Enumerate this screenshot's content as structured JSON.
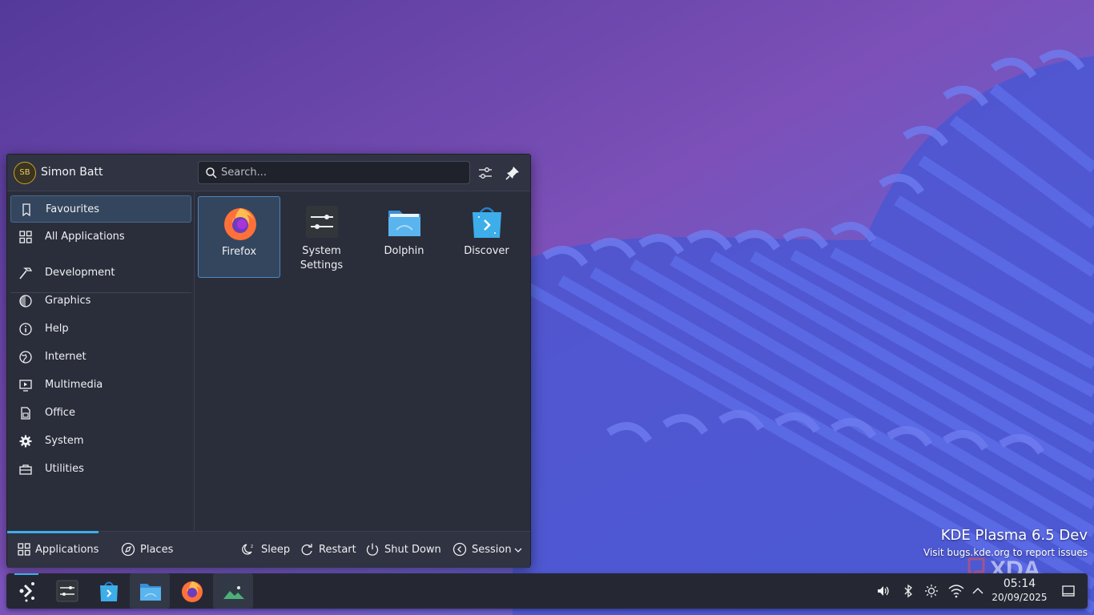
{
  "launcher": {
    "user": {
      "initials": "SB",
      "name": "Simon Batt"
    },
    "search": {
      "placeholder": "Search..."
    },
    "sidebar": {
      "items": [
        {
          "label": "Favourites",
          "icon": "bookmark-icon",
          "active": true
        },
        {
          "label": "All Applications",
          "icon": "grid-icon"
        },
        {
          "label": "Development",
          "icon": "hammer-icon"
        },
        {
          "label": "Graphics",
          "icon": "graphics-icon"
        },
        {
          "label": "Help",
          "icon": "info-icon"
        },
        {
          "label": "Internet",
          "icon": "globe-icon"
        },
        {
          "label": "Multimedia",
          "icon": "multimedia-icon"
        },
        {
          "label": "Office",
          "icon": "office-icon"
        },
        {
          "label": "System",
          "icon": "gear-icon"
        },
        {
          "label": "Utilities",
          "icon": "toolbox-icon"
        }
      ]
    },
    "favourites": [
      {
        "label": "Firefox",
        "icon": "firefox-icon",
        "active": true
      },
      {
        "label": "System\nSettings",
        "icon": "system-settings-icon"
      },
      {
        "label": "Dolphin",
        "icon": "dolphin-icon"
      },
      {
        "label": "Discover",
        "icon": "discover-icon"
      }
    ],
    "footer": {
      "tabs": [
        {
          "label": "Applications",
          "icon": "grid-icon",
          "active": true
        },
        {
          "label": "Places",
          "icon": "compass-icon"
        }
      ],
      "actions": [
        {
          "label": "Sleep",
          "icon": "sleep-icon"
        },
        {
          "label": "Restart",
          "icon": "restart-icon"
        },
        {
          "label": "Shut Down",
          "icon": "power-icon"
        },
        {
          "label": "Session",
          "icon": "session-icon"
        }
      ]
    }
  },
  "desktop": {
    "watermark_title": "KDE Plasma 6.5 Dev",
    "watermark_sub": "Visit bugs.kde.org to report issues",
    "xda_logo": "XDA"
  },
  "taskbar": {
    "tasks": [
      {
        "icon": "kde-launcher-icon"
      },
      {
        "icon": "system-settings-icon"
      },
      {
        "icon": "discover-icon"
      },
      {
        "icon": "dolphin-icon",
        "open": true
      },
      {
        "icon": "firefox-icon"
      },
      {
        "icon": "spectacle-icon",
        "open": true
      }
    ],
    "tray": [
      "volume-icon",
      "bluetooth-icon",
      "brightness-icon",
      "wifi-icon",
      "chevron-up-icon"
    ],
    "clock": {
      "time": "05:14",
      "date": "20/09/2025"
    }
  },
  "colors": {
    "accent": "#3daee9",
    "panel": "#2a2e3b",
    "taskbar": "#252833"
  }
}
